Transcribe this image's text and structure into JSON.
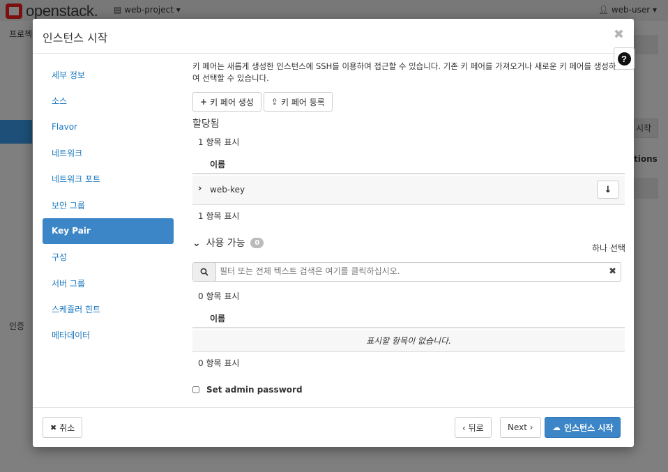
{
  "topbar": {
    "brand": "openstack.",
    "project": "web-project",
    "user": "web-user"
  },
  "background": {
    "breadcrumb_fragment": "프로젝",
    "launch_fragment": "시작",
    "actions_fragment": "tions",
    "auth_fragment": "인증"
  },
  "modal": {
    "title": "인스턴스 시작",
    "close_symbol": "✖",
    "help_symbol": "?"
  },
  "nav": {
    "items": [
      {
        "label": "세부 정보"
      },
      {
        "label": "소스"
      },
      {
        "label": "Flavor"
      },
      {
        "label": "네트워크"
      },
      {
        "label": "네트워크 포트"
      },
      {
        "label": "보안 그룹"
      },
      {
        "label": "Key Pair"
      },
      {
        "label": "구성"
      },
      {
        "label": "서버 그룹"
      },
      {
        "label": "스케쥴러 힌트"
      },
      {
        "label": "메타데이터"
      }
    ],
    "active_index": 6
  },
  "content": {
    "description": "키 페어는 새롭게 생성한 인스턴스에 SSH를 이용하여 접근할 수 있습니다. 기존 키 페어를 가져오거나 새로운 키 페어를 생성하여 선택할 수 있습니다.",
    "create_button": "키 페어 생성",
    "import_button": "키 페어 등록",
    "allocated": {
      "title": "할당됨",
      "count_top": "1 항목 표시",
      "column_name": "이름",
      "rows": [
        {
          "name": "web-key"
        }
      ],
      "count_bottom": "1 항목 표시"
    },
    "available": {
      "title": "사용 가능",
      "badge": "0",
      "select_hint": "하나 선택",
      "search_placeholder": "필터 또는 전체 텍스트 검색은 여기를 클릭하십시오.",
      "count_top": "0 항목 표시",
      "column_name": "이름",
      "empty_text": "표시할 항목이 없습니다.",
      "count_bottom": "0 항목 표시"
    },
    "admin_password_label": "Set admin password"
  },
  "footer": {
    "cancel": "취소",
    "back": "‹ 뒤로",
    "next": "Next ›",
    "launch": "인스턴스 시작"
  }
}
